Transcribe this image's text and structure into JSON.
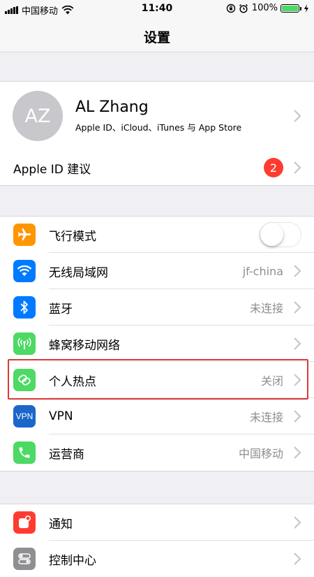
{
  "status_bar": {
    "carrier": "中国移动",
    "time": "11:40",
    "battery": "100%",
    "signal_icon": "signal-bars-icon",
    "wifi_icon": "wifi-icon"
  },
  "nav": {
    "title": "设置"
  },
  "profile": {
    "initials": "AZ",
    "name": "AL Zhang",
    "subtitle": "Apple ID、iCloud、iTunes 与 App Store"
  },
  "apple_id_suggestion": {
    "label": "Apple ID 建议",
    "badge": "2"
  },
  "network_group": [
    {
      "label": "飞行模式",
      "value": "",
      "icon": "airplane-icon",
      "color": "#ff9500",
      "toggle": false
    },
    {
      "label": "无线局域网",
      "value": "jf-china",
      "icon": "wifi-icon",
      "color": "#007aff"
    },
    {
      "label": "蓝牙",
      "value": "未连接",
      "icon": "bluetooth-icon",
      "color": "#007aff"
    },
    {
      "label": "蜂窝移动网络",
      "value": "",
      "icon": "cellular-antenna-icon",
      "color": "#4cd964"
    },
    {
      "label": "个人热点",
      "value": "关闭",
      "icon": "hotspot-link-icon",
      "color": "#4cd964"
    },
    {
      "label": "VPN",
      "value": "未连接",
      "icon": "vpn-icon",
      "icon_text": "VPN",
      "color": "#1a66c9"
    },
    {
      "label": "运营商",
      "value": "中国移动",
      "icon": "phone-icon",
      "color": "#4cd964"
    }
  ],
  "notify_group": [
    {
      "label": "通知",
      "icon": "notification-icon",
      "color": "#ff3b30"
    },
    {
      "label": "控制中心",
      "icon": "control-center-icon",
      "color": "#8e8e93"
    }
  ]
}
